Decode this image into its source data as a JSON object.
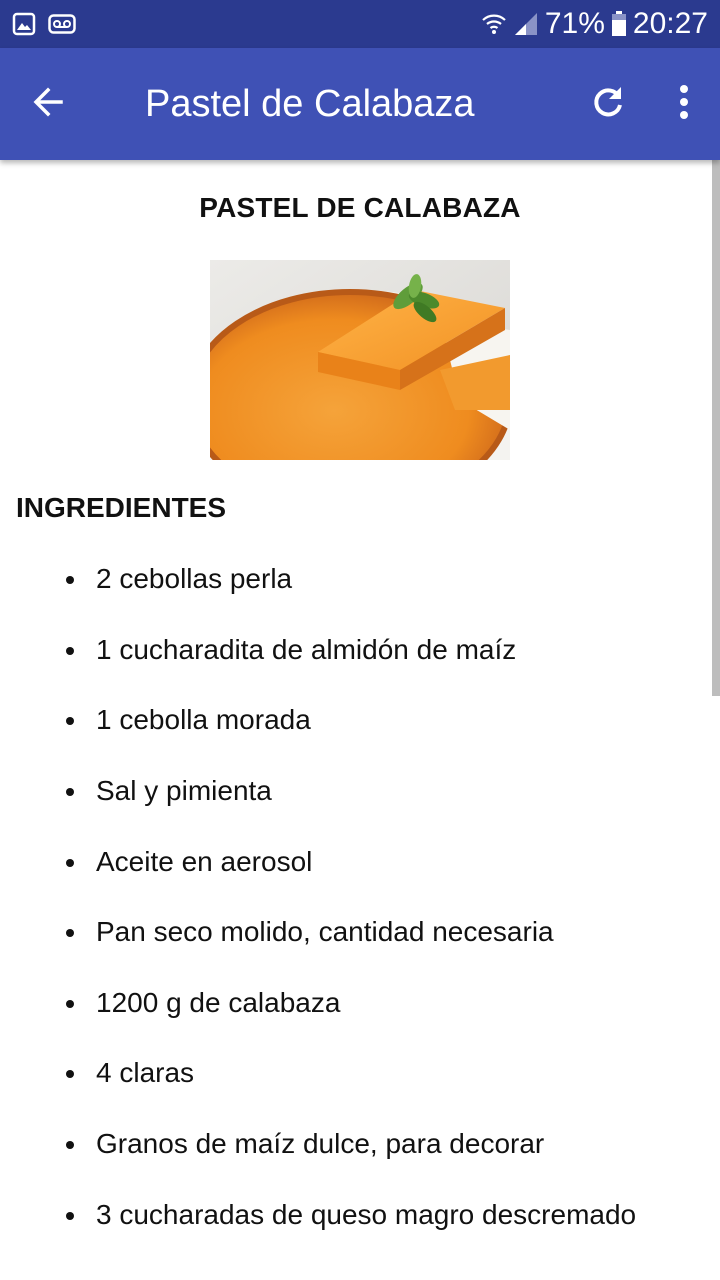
{
  "status_bar": {
    "battery": "71%",
    "time": "20:27",
    "icons": [
      "image-notification-icon",
      "voicemail-icon",
      "wifi-icon",
      "cell-signal-icon",
      "battery-icon"
    ]
  },
  "app_bar": {
    "title": "Pastel de Calabaza",
    "icons": [
      "back-arrow-icon",
      "refresh-icon",
      "more-vert-icon"
    ]
  },
  "recipe": {
    "title": "PASTEL DE CALABAZA",
    "ingredients_heading": "INGREDIENTES",
    "ingredients": [
      "2 cebollas perla",
      "1 cucharadita de almidón de maíz",
      "1 cebolla morada",
      "Sal y pimienta",
      "Aceite en aerosol",
      "Pan seco molido, cantidad necesaria",
      "1200 g de calabaza",
      "4 claras",
      "Granos de maíz dulce, para decorar",
      "3 cucharadas de queso magro descremado"
    ]
  },
  "colors": {
    "status_bar": "#2b3a8f",
    "app_bar": "#3f51b5",
    "text": "#111111",
    "pumpkin": "#f08a1e"
  }
}
